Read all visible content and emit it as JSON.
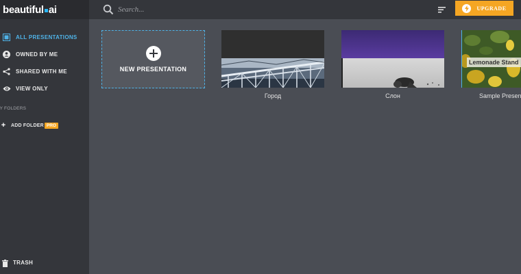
{
  "app": {
    "logo_text": "beautiful",
    "logo_suffix": "ai"
  },
  "sidebar": {
    "items": [
      {
        "label": "ALL PRESENTATIONS",
        "icon": "presentations-icon",
        "active": true
      },
      {
        "label": "OWNED BY ME",
        "icon": "person-icon",
        "active": false
      },
      {
        "label": "SHARED WITH ME",
        "icon": "share-icon",
        "active": false
      },
      {
        "label": "VIEW ONLY",
        "icon": "eye-icon",
        "active": false
      }
    ],
    "section_label": "MY FOLDERS",
    "add_folder_label": "ADD FOLDER",
    "pro_badge": "PRO",
    "trash_label": "TRASH"
  },
  "topbar": {
    "search_placeholder": "Search...",
    "upgrade_label": "UPGRADE"
  },
  "main": {
    "new_presentation_label": "NEW PRESENTATION",
    "presentations": [
      {
        "title": "Город"
      },
      {
        "title": "Слон"
      },
      {
        "title": "Sample Presentation",
        "slide_title": "Lemonade Stand"
      }
    ]
  },
  "colors": {
    "accent": "#4fb3e8",
    "upgrade": "#f5a623",
    "background": "#4a4d54",
    "sidebar": "#34363b"
  }
}
